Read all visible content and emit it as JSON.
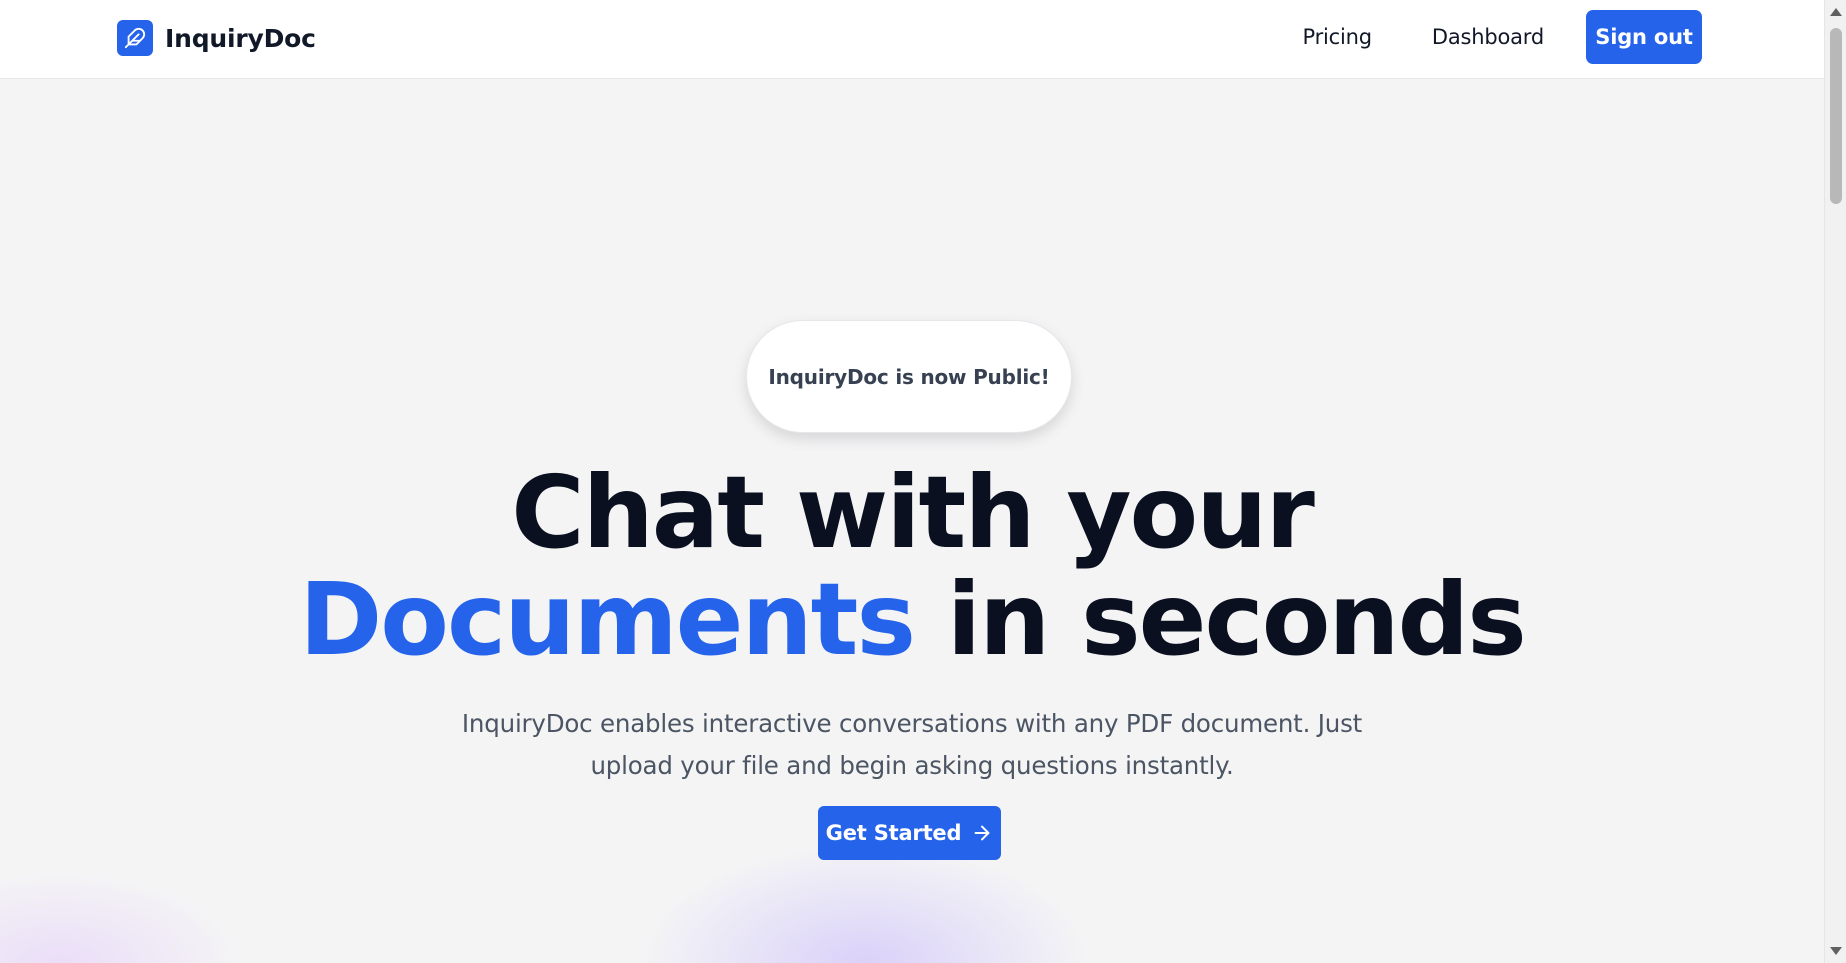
{
  "header": {
    "brand_name": "InquiryDoc",
    "brand_icon": "feather-icon",
    "nav": {
      "pricing_label": "Pricing",
      "dashboard_label": "Dashboard",
      "signout_label": "Sign out"
    }
  },
  "hero": {
    "announcement": "InquiryDoc is now Public!",
    "headline_line1": "Chat with your",
    "headline_accent": "Documents",
    "headline_rest": " in seconds",
    "description": "InquiryDoc enables interactive conversations with any PDF document. Just upload your file and begin asking questions instantly.",
    "cta_label": "Get Started",
    "cta_icon": "arrow-right-icon"
  },
  "colors": {
    "accent": "#2563eb",
    "headline": "#0b1020",
    "body_text": "#4b5563",
    "background": "#f4f4f5"
  }
}
